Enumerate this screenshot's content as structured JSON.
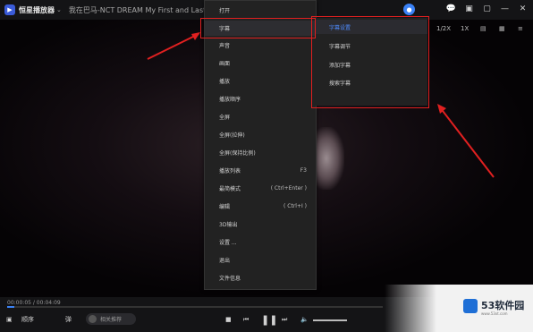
{
  "titlebar": {
    "app_name": "恒星播放器",
    "dropdown_glyph": "⌄",
    "song_title": "我在巴马-NCT DREAM   My First and Last (Korean Ver.)"
  },
  "window_controls": [
    "💬",
    "▣",
    "▢",
    "—",
    "✕"
  ],
  "toolbar_right": [
    "1/2X",
    "1X",
    "▤",
    "▦",
    "≡"
  ],
  "main_menu": {
    "items": [
      {
        "label": "打开",
        "shortcut": ""
      },
      {
        "label": "字幕",
        "shortcut": ""
      },
      {
        "label": "声音",
        "shortcut": ""
      },
      {
        "label": "画面",
        "shortcut": ""
      },
      {
        "label": "播放",
        "shortcut": ""
      },
      {
        "label": "播放顺序",
        "shortcut": ""
      },
      {
        "label": "全屏",
        "shortcut": ""
      },
      {
        "label": "全屏(拉伸)",
        "shortcut": ""
      },
      {
        "label": "全屏(保持比例)",
        "shortcut": ""
      },
      {
        "label": "播放列表",
        "shortcut": "F3"
      },
      {
        "label": "最简模式",
        "shortcut": "( Ctrl+Enter )"
      },
      {
        "label": "编辑",
        "shortcut": "( Ctrl+I )"
      },
      {
        "label": "3D输出",
        "shortcut": ""
      },
      {
        "label": "设置 ...",
        "shortcut": ""
      },
      {
        "label": "退出",
        "shortcut": ""
      },
      {
        "label": "文件信息",
        "shortcut": ""
      }
    ]
  },
  "sub_menu": {
    "items": [
      "字幕设置",
      "字幕调节",
      "添加字幕",
      "搜索字幕"
    ]
  },
  "playback": {
    "time": "00:00:05 / 00:04:09",
    "progress": 0.02,
    "mode_label": "顺序",
    "fav_label": "弹",
    "pill_label": "相关推荐",
    "volume": 1.0
  },
  "watermark": {
    "title": "53软件园",
    "subtitle": "www.53xt.com"
  }
}
